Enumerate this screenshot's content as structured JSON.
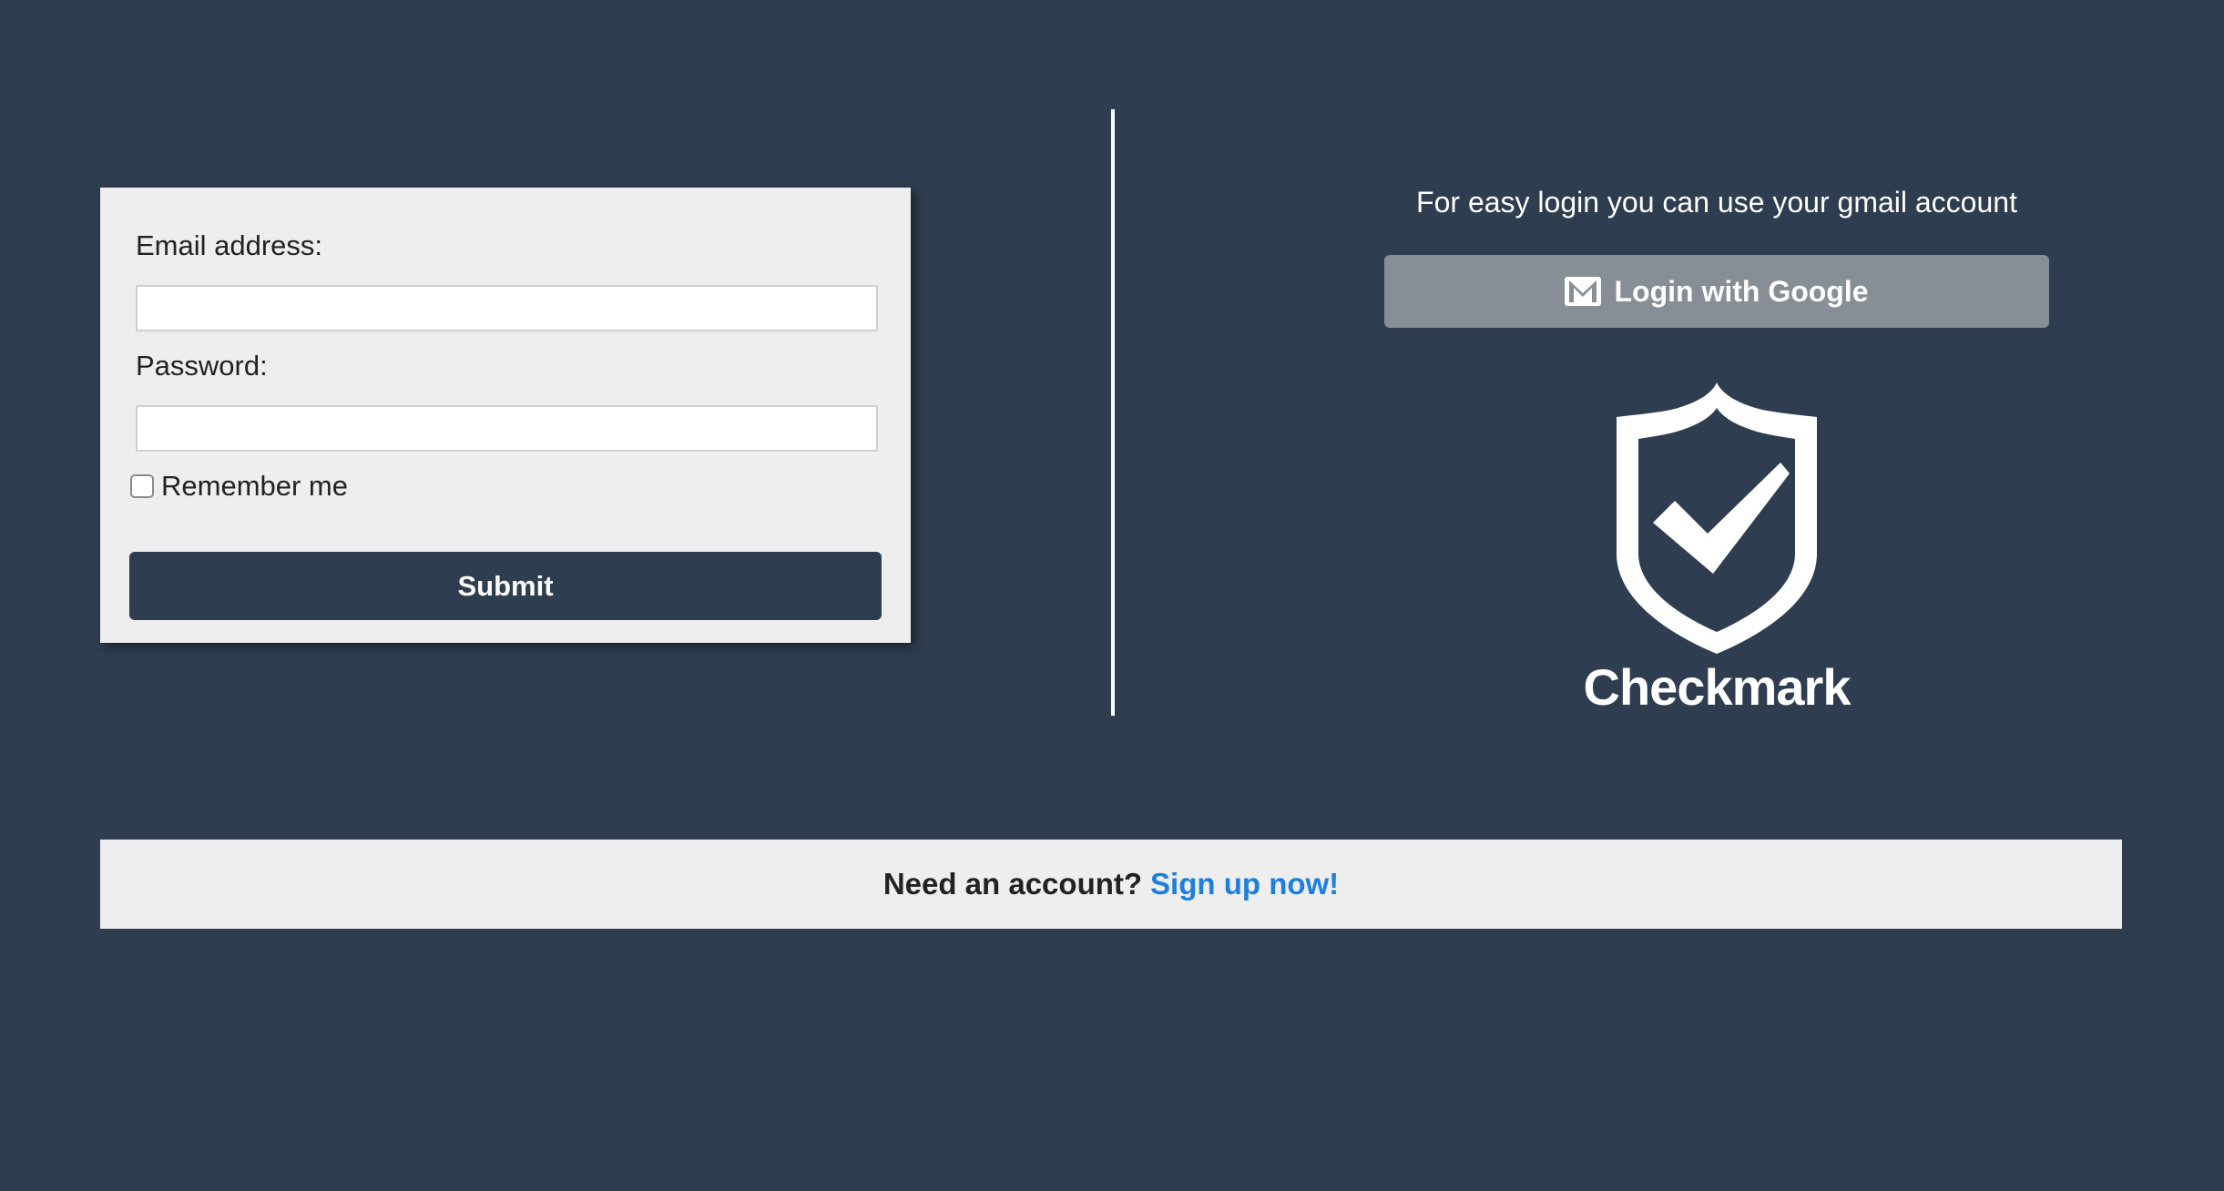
{
  "login_form": {
    "email_label": "Email address:",
    "email_value": "",
    "password_label": "Password:",
    "password_value": "",
    "remember_label": "Remember me",
    "remember_checked": false,
    "submit_label": "Submit"
  },
  "social_login": {
    "hint": "For easy login you can use your gmail account",
    "google_button_label": "Login with Google",
    "button_icon": "mail-icon"
  },
  "brand": {
    "logo_icon": "shield-check-icon",
    "name": "Checkmark"
  },
  "signup": {
    "question": "Need an account?",
    "link_text": "Sign up now!"
  },
  "colors": {
    "background": "#2e3d4f",
    "panel": "#eeeeee",
    "google_button": "#878e96",
    "link": "#1e7ee0"
  }
}
